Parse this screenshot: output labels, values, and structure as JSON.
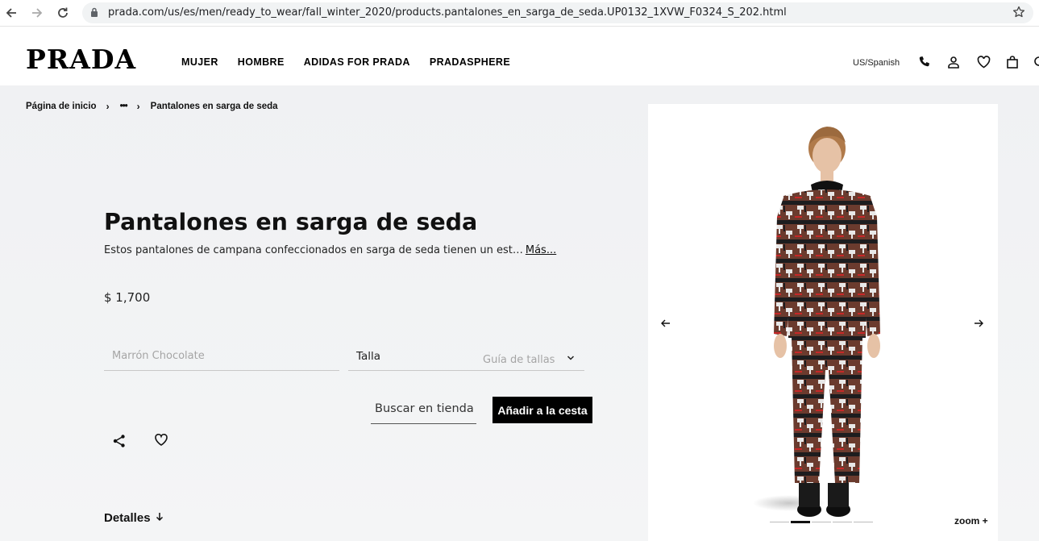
{
  "browser": {
    "url": "prada.com/us/es/men/ready_to_wear/fall_winter_2020/products.pantalones_en_sarga_de_seda.UP0132_1XVW_F0324_S_202.html"
  },
  "header": {
    "logo": "PRADA",
    "menu": [
      "MUJER",
      "HOMBRE",
      "ADIDAS FOR PRADA",
      "PRADASPHERE"
    ],
    "locale": "US/Spanish",
    "icons": [
      "phone-icon",
      "account-icon",
      "wishlist-icon",
      "bag-icon",
      "search-icon"
    ]
  },
  "breadcrumb": {
    "home": "Página de inicio",
    "ellipsis": "•••",
    "current": "Pantalones en sarga de seda"
  },
  "product": {
    "title": "Pantalones en sarga de seda",
    "description": "Estos pantalones de campana confeccionados en sarga de seda tienen un est…",
    "more_label": "Más...",
    "price": "$ 1,700",
    "color_placeholder": "Marrón Chocolate",
    "size_label": "Talla",
    "size_guide": "Guía de tallas",
    "find_store": "Buscar en tienda",
    "add_to_cart": "Añadir a la cesta",
    "details_label": "Detalles"
  },
  "gallery": {
    "zoom_label": "zoom +",
    "pages": 5,
    "active_page": 2
  },
  "colors": {
    "brand": "#000000",
    "pattern_brown": "#6b3b2e",
    "pattern_white": "#e8e8e8",
    "pattern_dark": "#1d1d1f"
  }
}
